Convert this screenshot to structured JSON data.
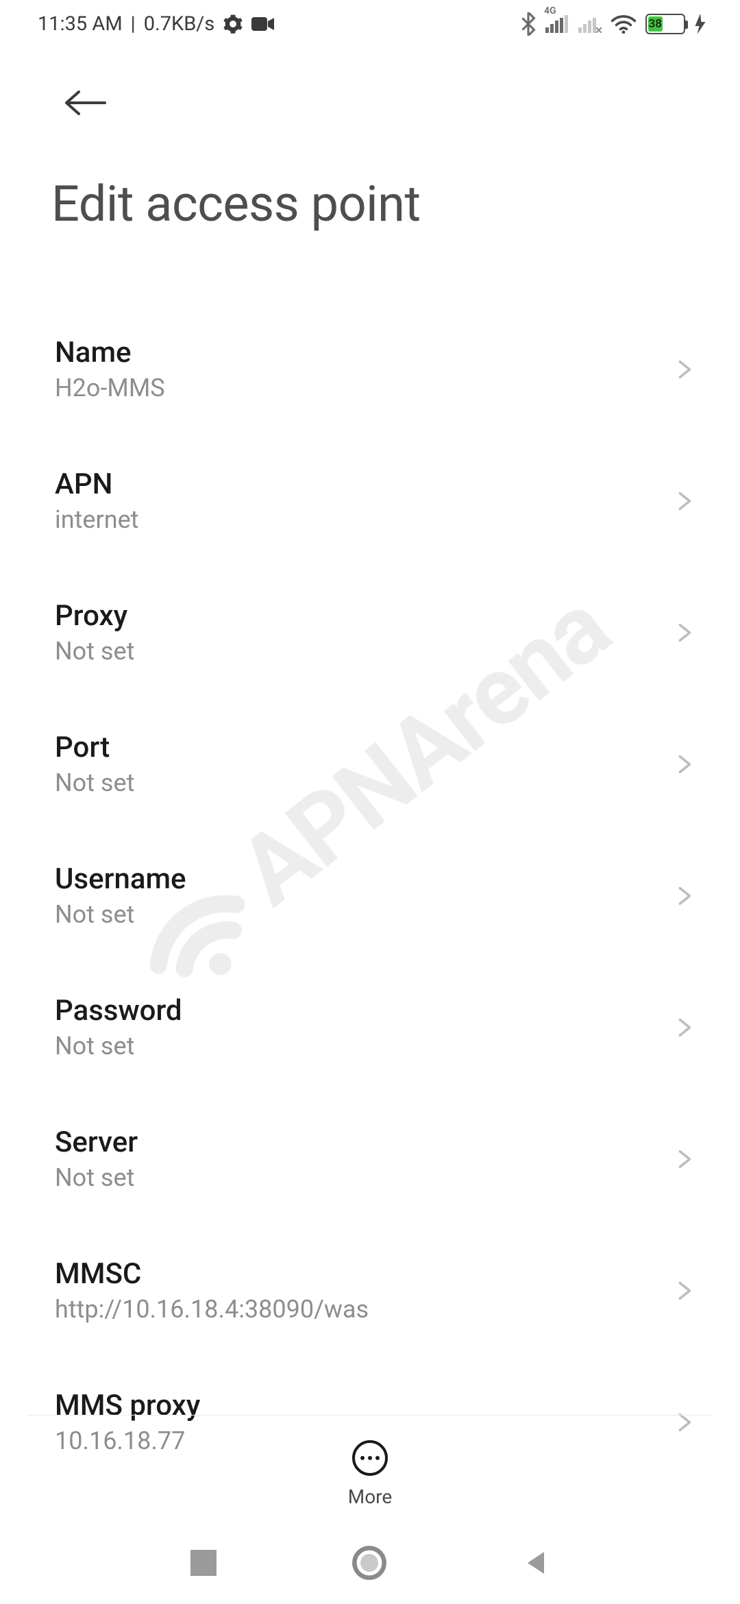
{
  "status": {
    "time": "11:35 AM",
    "net_rate": "0.7KB/s",
    "battery_pct": "38",
    "cell_label_4g": "4G"
  },
  "header": {
    "title": "Edit access point"
  },
  "fields": [
    {
      "label": "Name",
      "value": "H2o-MMS"
    },
    {
      "label": "APN",
      "value": "internet"
    },
    {
      "label": "Proxy",
      "value": "Not set"
    },
    {
      "label": "Port",
      "value": "Not set"
    },
    {
      "label": "Username",
      "value": "Not set"
    },
    {
      "label": "Password",
      "value": "Not set"
    },
    {
      "label": "Server",
      "value": "Not set"
    },
    {
      "label": "MMSC",
      "value": "http://10.16.18.4:38090/was"
    },
    {
      "label": "MMS proxy",
      "value": "10.16.18.77"
    }
  ],
  "bottom": {
    "more_label": "More"
  },
  "watermark": {
    "text": "APNArena"
  }
}
